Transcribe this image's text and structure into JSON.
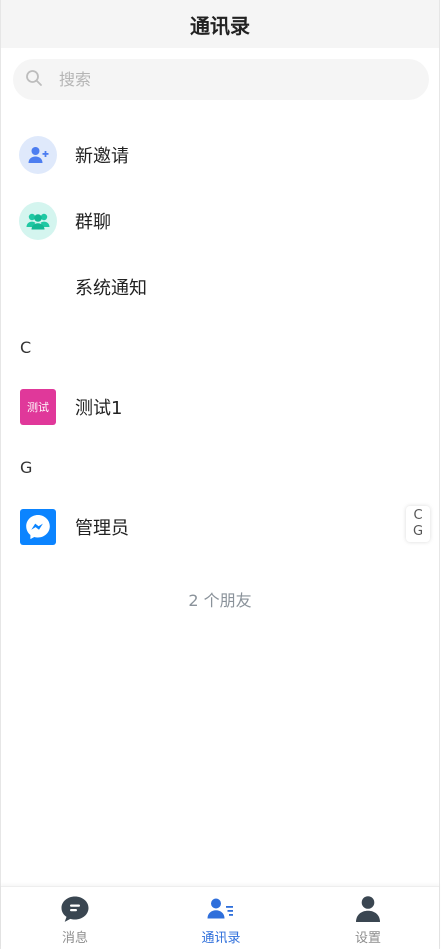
{
  "header": {
    "title": "通讯录"
  },
  "search": {
    "placeholder": "搜索",
    "icon": "search-icon"
  },
  "entries": [
    {
      "label": "新邀请",
      "icon": "add-user-icon"
    },
    {
      "label": "群聊",
      "icon": "group-icon"
    },
    {
      "label": "系统通知"
    }
  ],
  "sections": [
    {
      "letter": "C",
      "contacts": [
        {
          "name": "测试1",
          "avatar_text": "测试"
        }
      ]
    },
    {
      "letter": "G",
      "contacts": [
        {
          "name": "管理员",
          "avatar": "messenger-icon"
        }
      ]
    }
  ],
  "index_letters": [
    "C",
    "G"
  ],
  "friend_count": "2 个朋友",
  "tabbar": {
    "items": [
      {
        "label": "消息",
        "icon": "chat-bubble-icon"
      },
      {
        "label": "通讯录",
        "icon": "contacts-icon",
        "active": true
      },
      {
        "label": "设置",
        "icon": "person-icon"
      }
    ]
  },
  "colors": {
    "accent": "#2f6fdb",
    "header_bg": "#f5f5f5",
    "pink_avatar": "#e0389a",
    "messenger_blue": "#0b84ff"
  }
}
